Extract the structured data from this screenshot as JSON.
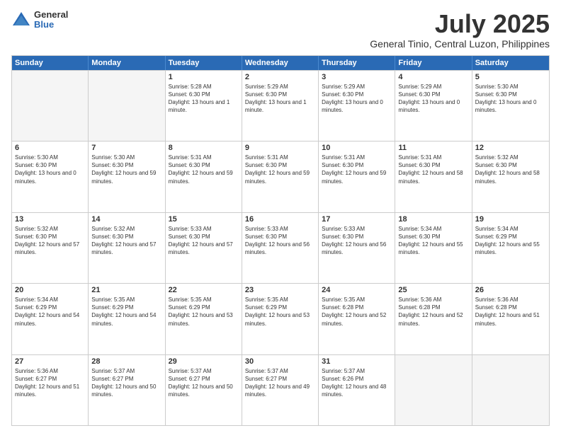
{
  "logo": {
    "general": "General",
    "blue": "Blue"
  },
  "title": "July 2025",
  "location": "General Tinio, Central Luzon, Philippines",
  "days": [
    "Sunday",
    "Monday",
    "Tuesday",
    "Wednesday",
    "Thursday",
    "Friday",
    "Saturday"
  ],
  "rows": [
    [
      {
        "date": "",
        "empty": true
      },
      {
        "date": "",
        "empty": true
      },
      {
        "date": "1",
        "sunrise": "Sunrise: 5:28 AM",
        "sunset": "Sunset: 6:30 PM",
        "daylight": "Daylight: 13 hours and 1 minute."
      },
      {
        "date": "2",
        "sunrise": "Sunrise: 5:29 AM",
        "sunset": "Sunset: 6:30 PM",
        "daylight": "Daylight: 13 hours and 1 minute."
      },
      {
        "date": "3",
        "sunrise": "Sunrise: 5:29 AM",
        "sunset": "Sunset: 6:30 PM",
        "daylight": "Daylight: 13 hours and 0 minutes."
      },
      {
        "date": "4",
        "sunrise": "Sunrise: 5:29 AM",
        "sunset": "Sunset: 6:30 PM",
        "daylight": "Daylight: 13 hours and 0 minutes."
      },
      {
        "date": "5",
        "sunrise": "Sunrise: 5:30 AM",
        "sunset": "Sunset: 6:30 PM",
        "daylight": "Daylight: 13 hours and 0 minutes."
      }
    ],
    [
      {
        "date": "6",
        "sunrise": "Sunrise: 5:30 AM",
        "sunset": "Sunset: 6:30 PM",
        "daylight": "Daylight: 13 hours and 0 minutes."
      },
      {
        "date": "7",
        "sunrise": "Sunrise: 5:30 AM",
        "sunset": "Sunset: 6:30 PM",
        "daylight": "Daylight: 12 hours and 59 minutes."
      },
      {
        "date": "8",
        "sunrise": "Sunrise: 5:31 AM",
        "sunset": "Sunset: 6:30 PM",
        "daylight": "Daylight: 12 hours and 59 minutes."
      },
      {
        "date": "9",
        "sunrise": "Sunrise: 5:31 AM",
        "sunset": "Sunset: 6:30 PM",
        "daylight": "Daylight: 12 hours and 59 minutes."
      },
      {
        "date": "10",
        "sunrise": "Sunrise: 5:31 AM",
        "sunset": "Sunset: 6:30 PM",
        "daylight": "Daylight: 12 hours and 59 minutes."
      },
      {
        "date": "11",
        "sunrise": "Sunrise: 5:31 AM",
        "sunset": "Sunset: 6:30 PM",
        "daylight": "Daylight: 12 hours and 58 minutes."
      },
      {
        "date": "12",
        "sunrise": "Sunrise: 5:32 AM",
        "sunset": "Sunset: 6:30 PM",
        "daylight": "Daylight: 12 hours and 58 minutes."
      }
    ],
    [
      {
        "date": "13",
        "sunrise": "Sunrise: 5:32 AM",
        "sunset": "Sunset: 6:30 PM",
        "daylight": "Daylight: 12 hours and 57 minutes."
      },
      {
        "date": "14",
        "sunrise": "Sunrise: 5:32 AM",
        "sunset": "Sunset: 6:30 PM",
        "daylight": "Daylight: 12 hours and 57 minutes."
      },
      {
        "date": "15",
        "sunrise": "Sunrise: 5:33 AM",
        "sunset": "Sunset: 6:30 PM",
        "daylight": "Daylight: 12 hours and 57 minutes."
      },
      {
        "date": "16",
        "sunrise": "Sunrise: 5:33 AM",
        "sunset": "Sunset: 6:30 PM",
        "daylight": "Daylight: 12 hours and 56 minutes."
      },
      {
        "date": "17",
        "sunrise": "Sunrise: 5:33 AM",
        "sunset": "Sunset: 6:30 PM",
        "daylight": "Daylight: 12 hours and 56 minutes."
      },
      {
        "date": "18",
        "sunrise": "Sunrise: 5:34 AM",
        "sunset": "Sunset: 6:30 PM",
        "daylight": "Daylight: 12 hours and 55 minutes."
      },
      {
        "date": "19",
        "sunrise": "Sunrise: 5:34 AM",
        "sunset": "Sunset: 6:29 PM",
        "daylight": "Daylight: 12 hours and 55 minutes."
      }
    ],
    [
      {
        "date": "20",
        "sunrise": "Sunrise: 5:34 AM",
        "sunset": "Sunset: 6:29 PM",
        "daylight": "Daylight: 12 hours and 54 minutes."
      },
      {
        "date": "21",
        "sunrise": "Sunrise: 5:35 AM",
        "sunset": "Sunset: 6:29 PM",
        "daylight": "Daylight: 12 hours and 54 minutes."
      },
      {
        "date": "22",
        "sunrise": "Sunrise: 5:35 AM",
        "sunset": "Sunset: 6:29 PM",
        "daylight": "Daylight: 12 hours and 53 minutes."
      },
      {
        "date": "23",
        "sunrise": "Sunrise: 5:35 AM",
        "sunset": "Sunset: 6:29 PM",
        "daylight": "Daylight: 12 hours and 53 minutes."
      },
      {
        "date": "24",
        "sunrise": "Sunrise: 5:35 AM",
        "sunset": "Sunset: 6:28 PM",
        "daylight": "Daylight: 12 hours and 52 minutes."
      },
      {
        "date": "25",
        "sunrise": "Sunrise: 5:36 AM",
        "sunset": "Sunset: 6:28 PM",
        "daylight": "Daylight: 12 hours and 52 minutes."
      },
      {
        "date": "26",
        "sunrise": "Sunrise: 5:36 AM",
        "sunset": "Sunset: 6:28 PM",
        "daylight": "Daylight: 12 hours and 51 minutes."
      }
    ],
    [
      {
        "date": "27",
        "sunrise": "Sunrise: 5:36 AM",
        "sunset": "Sunset: 6:27 PM",
        "daylight": "Daylight: 12 hours and 51 minutes."
      },
      {
        "date": "28",
        "sunrise": "Sunrise: 5:37 AM",
        "sunset": "Sunset: 6:27 PM",
        "daylight": "Daylight: 12 hours and 50 minutes."
      },
      {
        "date": "29",
        "sunrise": "Sunrise: 5:37 AM",
        "sunset": "Sunset: 6:27 PM",
        "daylight": "Daylight: 12 hours and 50 minutes."
      },
      {
        "date": "30",
        "sunrise": "Sunrise: 5:37 AM",
        "sunset": "Sunset: 6:27 PM",
        "daylight": "Daylight: 12 hours and 49 minutes."
      },
      {
        "date": "31",
        "sunrise": "Sunrise: 5:37 AM",
        "sunset": "Sunset: 6:26 PM",
        "daylight": "Daylight: 12 hours and 48 minutes."
      },
      {
        "date": "",
        "empty": true
      },
      {
        "date": "",
        "empty": true
      }
    ]
  ]
}
